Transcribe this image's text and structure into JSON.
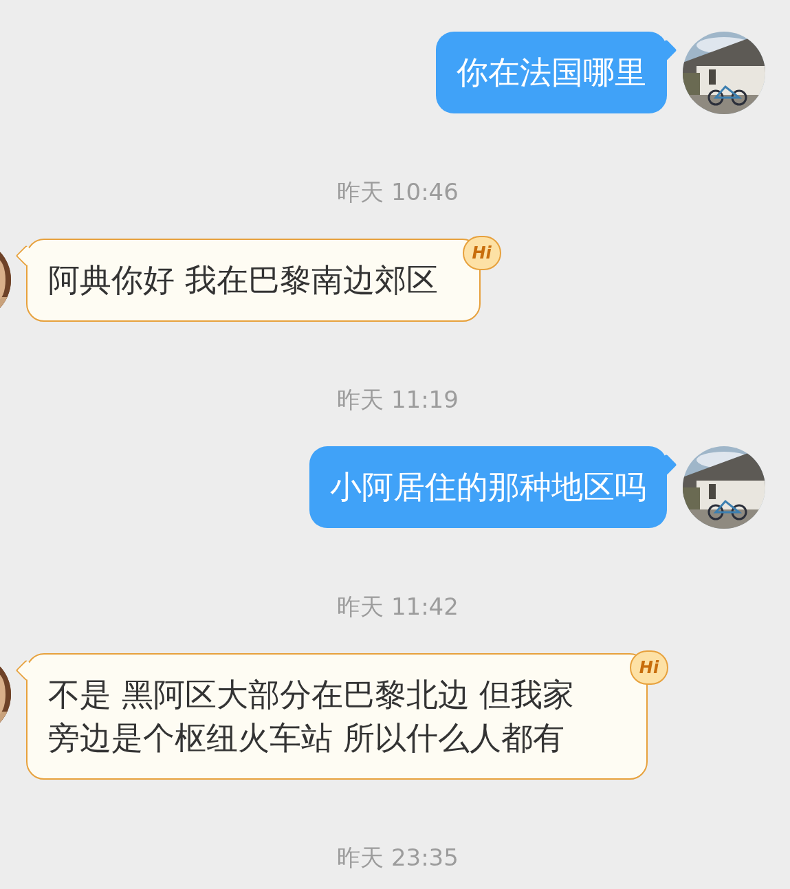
{
  "messages": [
    {
      "kind": "sent",
      "text": "你在法国哪里"
    },
    {
      "kind": "time",
      "text": "昨天 10:46"
    },
    {
      "kind": "received",
      "text": "阿典你好 我在巴黎南边郊区",
      "badge": "Hi"
    },
    {
      "kind": "time",
      "text": "昨天 11:19"
    },
    {
      "kind": "sent",
      "text": "小阿居住的那种地区吗"
    },
    {
      "kind": "time",
      "text": "昨天 11:42"
    },
    {
      "kind": "received",
      "text": "不是 黑阿区大部分在巴黎北边 但我家旁边是个枢纽火车站 所以什么人都有",
      "badge": "Hi"
    },
    {
      "kind": "time",
      "text": "昨天 23:35"
    }
  ]
}
